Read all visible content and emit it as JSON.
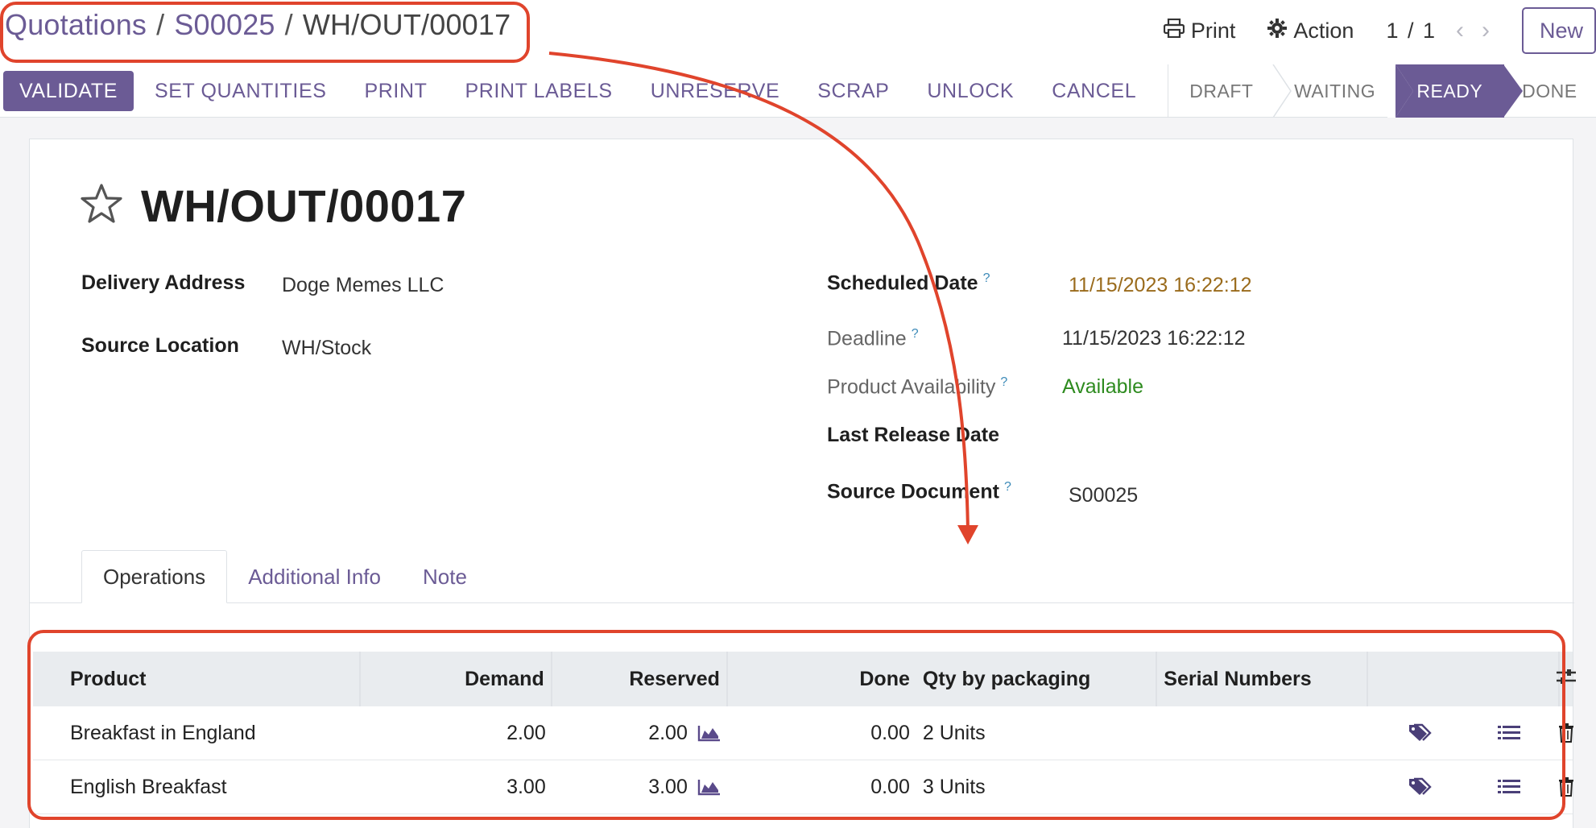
{
  "breadcrumb": {
    "items": [
      "Quotations",
      "S00025"
    ],
    "separator": "/",
    "current": "WH/OUT/00017"
  },
  "topright": {
    "print_label": "Print",
    "action_label": "Action",
    "pager": "1 / 1",
    "new_label": "New"
  },
  "actions": {
    "validate": "VALIDATE",
    "set_quantities": "SET QUANTITIES",
    "print": "PRINT",
    "print_labels": "PRINT LABELS",
    "unreserve": "UNRESERVE",
    "scrap": "SCRAP",
    "unlock": "UNLOCK",
    "cancel": "CANCEL"
  },
  "status": {
    "stages": [
      "DRAFT",
      "WAITING",
      "READY",
      "DONE"
    ],
    "active": "READY"
  },
  "record": {
    "title": "WH/OUT/00017",
    "left_fields": {
      "delivery_address_label": "Delivery Address",
      "delivery_address_value": "Doge Memes LLC",
      "source_location_label": "Source Location",
      "source_location_value": "WH/Stock"
    },
    "right_fields": {
      "scheduled_date_label": "Scheduled Date",
      "scheduled_date_value": "11/15/2023 16:22:12",
      "deadline_label": "Deadline",
      "deadline_value": "11/15/2023 16:22:12",
      "product_availability_label": "Product Availability",
      "product_availability_value": "Available",
      "last_release_label": "Last Release Date",
      "source_document_label": "Source Document",
      "source_document_value": "S00025"
    },
    "help_mark": "?"
  },
  "tabs": [
    "Operations",
    "Additional Info",
    "Note"
  ],
  "operations": {
    "columns": [
      "Product",
      "Demand",
      "Reserved",
      "Done",
      "Qty by packaging",
      "Serial Numbers"
    ],
    "rows": [
      {
        "product": "Breakfast in England",
        "demand": "2.00",
        "reserved": "2.00",
        "done": "0.00",
        "packaging": "2 Units",
        "serials": ""
      },
      {
        "product": "English Breakfast",
        "demand": "3.00",
        "reserved": "3.00",
        "done": "0.00",
        "packaging": "3 Units",
        "serials": ""
      }
    ]
  },
  "colors": {
    "brand": "#6b5b95",
    "annotation": "#e0442c",
    "scheduled_date": "#9a6b1c",
    "available": "#2e8b1f",
    "help": "#3c8ab8"
  },
  "icons": {
    "print": "printer-icon",
    "action": "gear-icon",
    "star": "star-outline-icon",
    "forecast": "area-chart-icon",
    "tag": "tag-icon",
    "details": "list-icon",
    "delete": "trash-icon",
    "optional_columns": "sliders-icon"
  }
}
